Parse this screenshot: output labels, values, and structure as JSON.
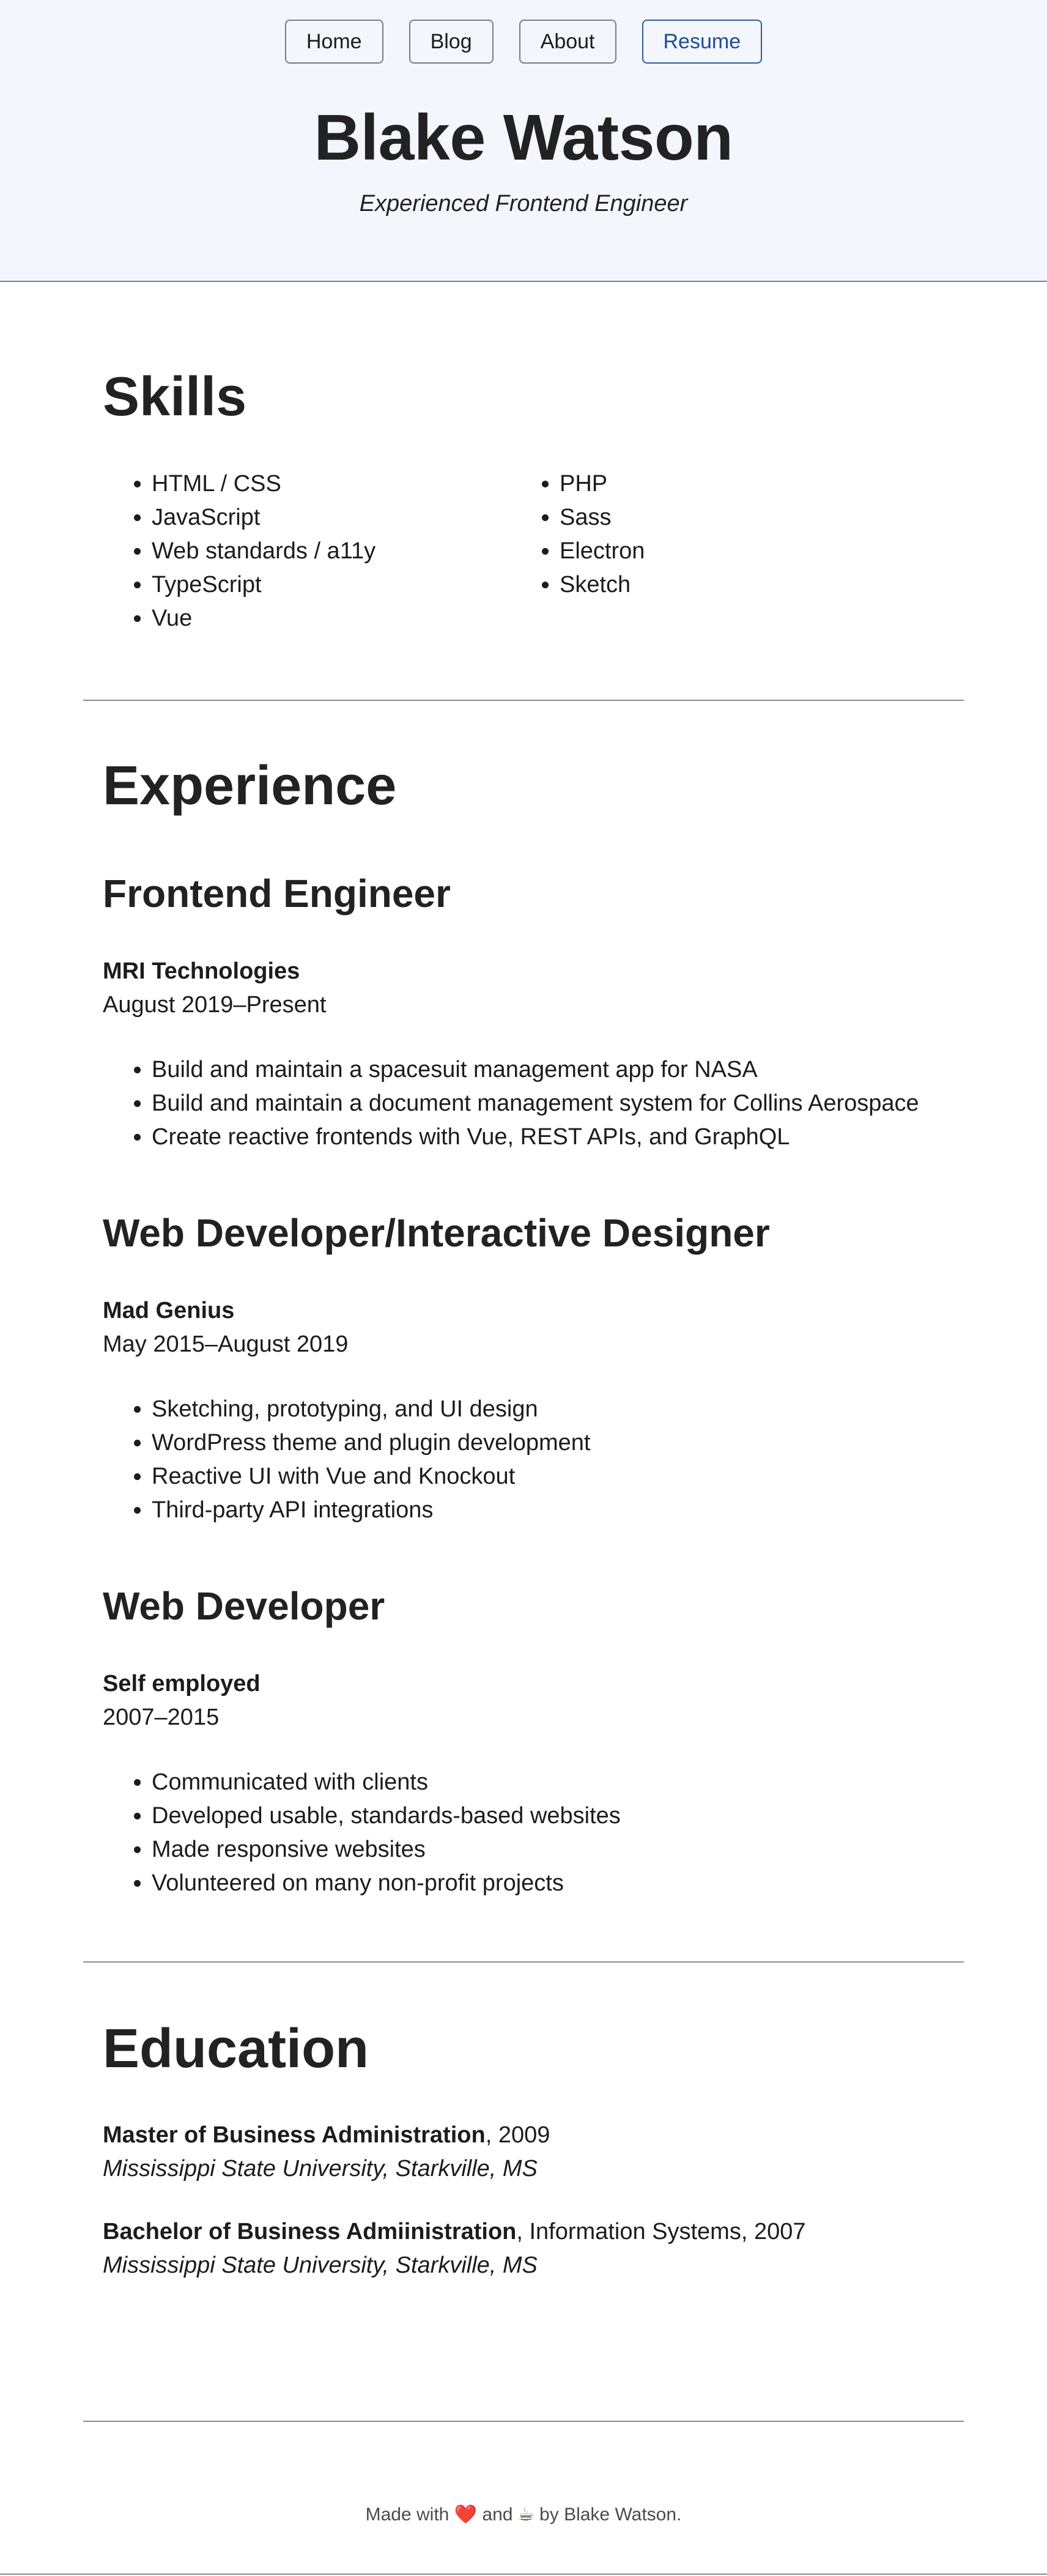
{
  "nav": {
    "items": [
      {
        "label": "Home"
      },
      {
        "label": "Blog"
      },
      {
        "label": "About"
      },
      {
        "label": "Resume"
      }
    ]
  },
  "header": {
    "title": "Blake Watson",
    "subtitle": "Experienced Frontend Engineer"
  },
  "skills": {
    "heading": "Skills",
    "left": [
      "HTML / CSS",
      "JavaScript",
      "Web standards / a11y",
      "TypeScript",
      "Vue"
    ],
    "right": [
      "PHP",
      "Sass",
      "Electron",
      "Sketch"
    ]
  },
  "experience": {
    "heading": "Experience",
    "jobs": [
      {
        "title": "Frontend Engineer",
        "company": "MRI Technologies",
        "dates": "August 2019–Present",
        "bullets": [
          "Build and maintain a spacesuit management app for NASA",
          "Build and maintain a document management system for Collins Aerospace",
          "Create reactive frontends with Vue, REST APIs, and GraphQL"
        ]
      },
      {
        "title": "Web Developer/Interactive Designer",
        "company": "Mad Genius",
        "dates": "May 2015–August 2019",
        "bullets": [
          "Sketching, prototyping, and UI design",
          "WordPress theme and plugin development",
          "Reactive UI with Vue and Knockout",
          "Third-party API integrations"
        ]
      },
      {
        "title": "Web Developer",
        "company": "Self employed",
        "dates": "2007–2015",
        "bullets": [
          "Communicated with clients",
          "Developed usable, standards-based websites",
          "Made responsive websites",
          "Volunteered on many non-profit projects"
        ]
      }
    ]
  },
  "education": {
    "heading": "Education",
    "entries": [
      {
        "degree": "Master of Business Administration",
        "detail": ", 2009",
        "school": "Mississippi State University, Starkville, MS"
      },
      {
        "degree": "Bachelor of Business Admiinistration",
        "detail": ", Information Systems, 2007",
        "school": "Mississippi State University, Starkville, MS"
      }
    ]
  },
  "footer": {
    "prefix": "Made with",
    "heart": "❤️",
    "and": "and",
    "coffee": "☕",
    "suffix": "by Blake Watson."
  },
  "colors": {
    "header_bg": "#f3f6fd",
    "accent": "#1f4c91",
    "text": "#222222"
  }
}
